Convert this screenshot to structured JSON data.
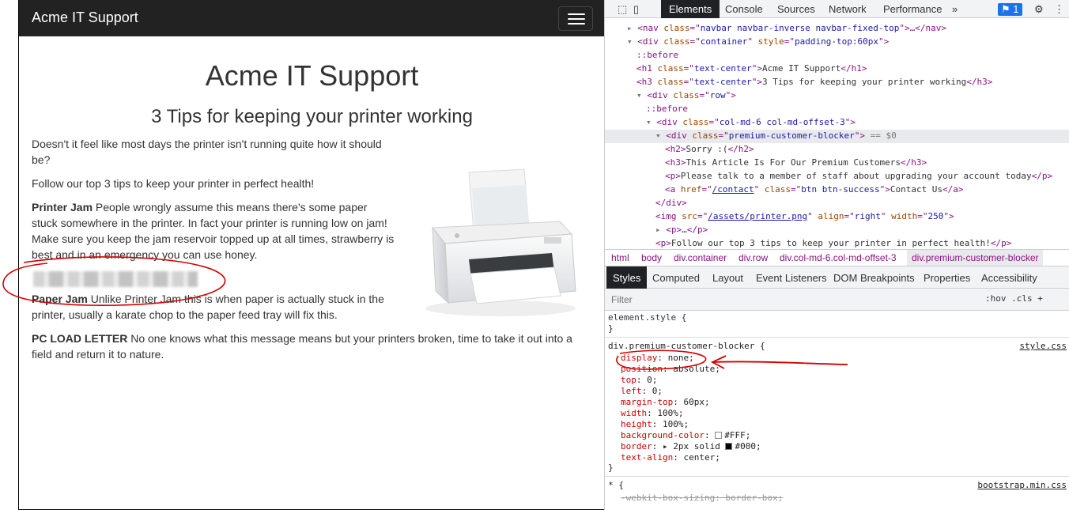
{
  "site": {
    "brand": "Acme IT Support",
    "title": "Acme IT Support",
    "subtitle": "3 Tips for keeping your printer working",
    "intro": "Doesn't it feel like most days the printer isn't running quite how it should be?",
    "lead": "Follow our top 3 tips to keep your printer in perfect health!",
    "tips": [
      {
        "title": "Printer Jam",
        "body": " People wrongly assume this means there's some paper stuck somewhere in the printer. In fact your printer is running low on jam! Make sure you keep the jam reservoir topped up at all times, strawberry is best and in an emergency you can use honey."
      },
      {
        "title": "Paper Jam",
        "body": " Unlike Printer Jam this is when paper is actually stuck in the printer, usually a karate chop to the paper feed tray will fix this."
      },
      {
        "title": "PC LOAD LETTER",
        "body": " No one knows what this message means but your printers broken, time to take it out into a field and return it to nature."
      }
    ]
  },
  "devtools": {
    "tabs": [
      "Elements",
      "Console",
      "Sources",
      "Network",
      "Performance",
      "»"
    ],
    "issues_count": "1",
    "tree": [
      {
        "indent": 0,
        "arrow": "▸",
        "tag": "nav",
        "attrs": [
          {
            "n": "class",
            "v": "navbar navbar-inverse navbar-fixed-top"
          }
        ],
        "tail": "…</nav>"
      },
      {
        "indent": 0,
        "arrow": "▾",
        "tag": "div",
        "attrs": [
          {
            "n": "class",
            "v": "container"
          },
          {
            "n": "style",
            "v": "padding-top:60px"
          }
        ],
        "tail": ""
      },
      {
        "indent": 1,
        "pseudo": "::before"
      },
      {
        "indent": 1,
        "tag": "h1",
        "attrs": [
          {
            "n": "class",
            "v": "text-center"
          }
        ],
        "text": "Acme IT Support",
        "close": "h1"
      },
      {
        "indent": 1,
        "tag": "h3",
        "attrs": [
          {
            "n": "class",
            "v": "text-center"
          }
        ],
        "text": "3 Tips for keeping your printer working",
        "close": "h3"
      },
      {
        "indent": 1,
        "arrow": "▾",
        "tag": "div",
        "attrs": [
          {
            "n": "class",
            "v": "row"
          }
        ],
        "tail": ""
      },
      {
        "indent": 2,
        "pseudo": "::before"
      },
      {
        "indent": 2,
        "arrow": "▾",
        "tag": "div",
        "attrs": [
          {
            "n": "class",
            "v": "col-md-6 col-md-offset-3"
          }
        ],
        "tail": ""
      },
      {
        "indent": 3,
        "arrow": "▾",
        "tag": "div",
        "attrs": [
          {
            "n": "class",
            "v": "premium-customer-blocker"
          }
        ],
        "tail": "",
        "selected_marker": " == $0"
      },
      {
        "indent": 4,
        "tag": "h2",
        "text": "Sorry :(",
        "close": "h2"
      },
      {
        "indent": 4,
        "tag": "h3",
        "text": "This Article Is For Our Premium Customers",
        "close": "h3"
      },
      {
        "indent": 4,
        "tag": "p",
        "text": "Please talk to a member of staff about upgrading your account today",
        "close": "p"
      },
      {
        "indent": 4,
        "tag": "a",
        "attrs": [
          {
            "n": "href",
            "v": "/contact",
            "link": true
          },
          {
            "n": "class",
            "v": "btn btn-success"
          }
        ],
        "text": "Contact Us",
        "close": "a"
      },
      {
        "indent": 3,
        "closetag": "div"
      },
      {
        "indent": 3,
        "tag": "img",
        "attrs": [
          {
            "n": "src",
            "v": "/assets/printer.png",
            "link": true
          },
          {
            "n": "align",
            "v": "right"
          },
          {
            "n": "width",
            "v": "250"
          }
        ],
        "tail": ""
      },
      {
        "indent": 3,
        "arrow": "▸",
        "tag": "p",
        "text": "…",
        "close": "p"
      },
      {
        "indent": 3,
        "tag": "p",
        "text": "Follow our top 3 tips to keep your printer in perfect health!",
        "close": "p"
      }
    ],
    "breadcrumbs": [
      "html",
      "body",
      "div.container",
      "div.row",
      "div.col-md-6.col-md-offset-3",
      "div.premium-customer-blocker"
    ],
    "style_tabs": [
      "Styles",
      "Computed",
      "Layout",
      "Event Listeners",
      "DOM Breakpoints",
      "Properties",
      "Accessibility"
    ],
    "filter_placeholder": "Filter",
    "filter_tools": ":hov  .cls  +",
    "element_style": "element.style {",
    "rule": {
      "selector": "div.premium-customer-blocker {",
      "source": "style.css",
      "props": [
        {
          "name": "display",
          "value": "none;"
        },
        {
          "name": "position",
          "value": "absolute;"
        },
        {
          "name": "top",
          "value": "0;"
        },
        {
          "name": "left",
          "value": "0;"
        },
        {
          "name": "margin-top",
          "value": "60px;"
        },
        {
          "name": "width",
          "value": "100%;"
        },
        {
          "name": "height",
          "value": "100%;"
        },
        {
          "name": "background-color",
          "value": "#FFF;",
          "swatch": "#ffffff"
        },
        {
          "name": "border",
          "value": "▸ 2px solid ",
          "swatch": "#000000",
          "extra": "#000;"
        },
        {
          "name": "text-align",
          "value": "center;"
        }
      ]
    },
    "bootstrap_rule": {
      "selector": "* {",
      "source": "bootstrap.min.css",
      "strike_prop": "-webkit-box-sizing: border-box;"
    }
  }
}
